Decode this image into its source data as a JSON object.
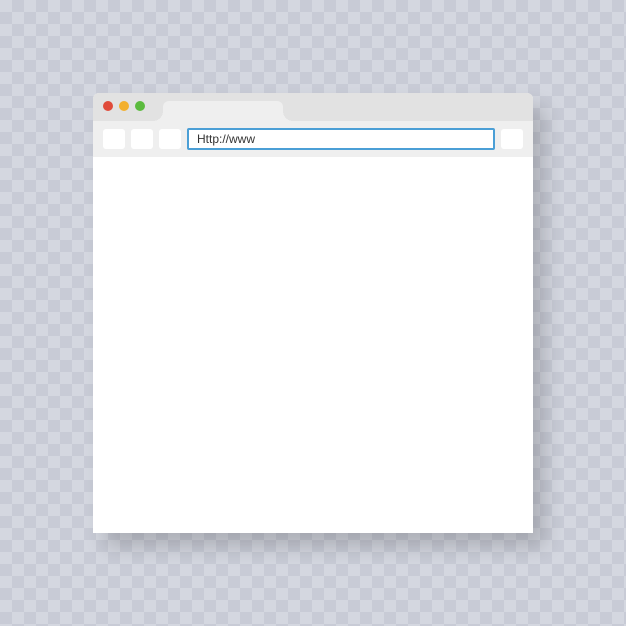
{
  "window": {
    "controls": {
      "close_color": "#e04b3a",
      "minimize_color": "#f3b02e",
      "maximize_color": "#5bbb3e"
    }
  },
  "toolbar": {
    "address_value": "Http://www",
    "nav_buttons": [
      {
        "name": "back"
      },
      {
        "name": "forward"
      },
      {
        "name": "refresh"
      }
    ]
  }
}
